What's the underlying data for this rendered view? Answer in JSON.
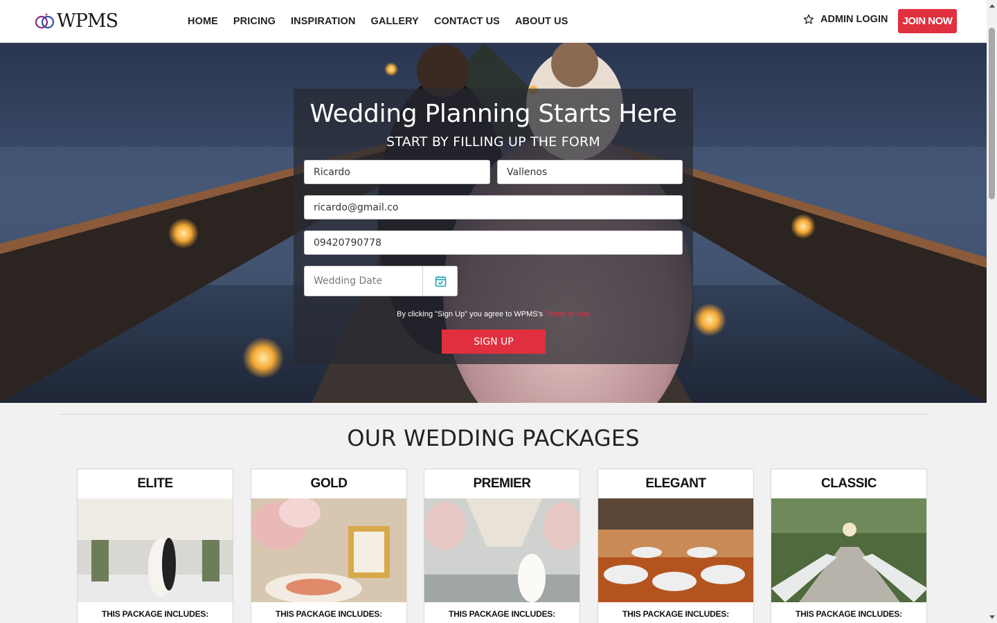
{
  "header": {
    "logo_text": "WPMS",
    "nav": [
      "HOME",
      "PRICING",
      "INSPIRATION",
      "GALLERY",
      "CONTACT US",
      "ABOUT US"
    ],
    "admin_login": "ADMIN LOGIN",
    "join_now": "JOIN NOW"
  },
  "hero": {
    "title": "Wedding Planning Starts Here",
    "subtitle": "START BY FILLING UP THE FORM",
    "first_name": "Ricardo",
    "last_name": "Vallenos",
    "email": "ricardo@gmail.co",
    "phone": "09420790778",
    "wedding_date_placeholder": "Wedding Date",
    "terms_prefix": "By clicking \"Sign Up\" you agree to WPMS's ",
    "terms_link": "Terms of Use",
    "signup": "SIGN UP"
  },
  "packages": {
    "title": "OUR WEDDING PACKAGES",
    "items": [
      {
        "name": "ELITE",
        "includes": "THIS PACKAGE INCLUDES:"
      },
      {
        "name": "GOLD",
        "includes": "THIS PACKAGE INCLUDES:"
      },
      {
        "name": "PREMIER",
        "includes": "THIS PACKAGE INCLUDES:"
      },
      {
        "name": "ELEGANT",
        "includes": "THIS PACKAGE INCLUDES:"
      },
      {
        "name": "CLASSIC",
        "includes": "THIS PACKAGE INCLUDES:"
      }
    ]
  },
  "colors": {
    "accent": "#e0303f",
    "header_bg": "#ffffff",
    "page_bg": "#f1f1f1"
  }
}
